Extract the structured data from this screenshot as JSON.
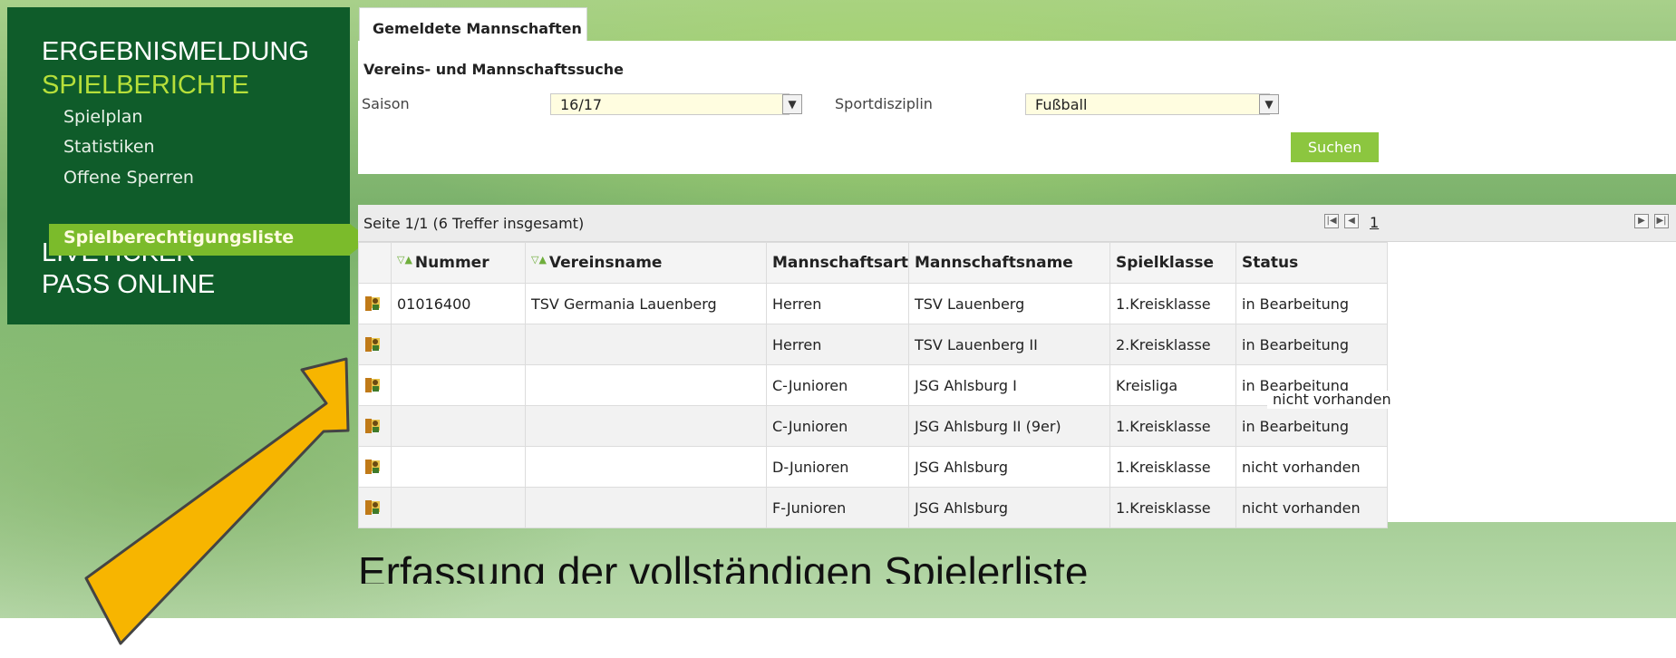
{
  "sidebar": {
    "heading_1": "ERGEBNISMELDUNG",
    "heading_2": "SPIELBERICHTE",
    "items": [
      "Spielplan",
      "Statistiken",
      "Offene Sperren"
    ],
    "active_item": "Spielberechtigungsliste",
    "heading_3": "LIVETICKER",
    "heading_4": "PASS ONLINE"
  },
  "tab": {
    "label": "Gemeldete Mannschaften"
  },
  "search": {
    "title": "Vereins- und Mannschaftssuche",
    "saison_label": "Saison",
    "saison_value": "16/17",
    "sportdisziplin_label": "Sportdisziplin",
    "sportdisziplin_value": "Fußball",
    "button_label": "Suchen"
  },
  "results": {
    "info": "Seite 1/1 (6 Treffer insgesamt)",
    "current_page": "1",
    "columns": [
      "Nummer",
      "Vereinsname",
      "Mannschaftsart",
      "Mannschaftsname",
      "Spielklasse",
      "Status"
    ],
    "rows": [
      {
        "nummer": "01016400",
        "vereinsname": "TSV Germania Lauenberg",
        "art": "Herren",
        "name": "TSV Lauenberg",
        "klasse": "1.Kreisklasse",
        "status": "in Bearbeitung"
      },
      {
        "nummer": "",
        "vereinsname": "",
        "art": "Herren",
        "name": "TSV Lauenberg II",
        "klasse": "2.Kreisklasse",
        "status": "in Bearbeitung"
      },
      {
        "nummer": "",
        "vereinsname": "",
        "art": "C-Junioren",
        "name": "JSG Ahlsburg I",
        "klasse": "Kreisliga",
        "status": "in Bearbeitung"
      },
      {
        "nummer": "",
        "vereinsname": "",
        "art": "C-Junioren",
        "name": "JSG Ahlsburg II (9er)",
        "klasse": "1.Kreisklasse",
        "status": "in Bearbeitung"
      },
      {
        "nummer": "",
        "vereinsname": "",
        "art": "D-Junioren",
        "name": "JSG Ahlsburg",
        "klasse": "1.Kreisklasse",
        "status": "nicht vorhanden"
      },
      {
        "nummer": "",
        "vereinsname": "",
        "art": "F-Junioren",
        "name": "JSG Ahlsburg",
        "klasse": "1.Kreisklasse",
        "status": "nicht vorhanden"
      }
    ],
    "overlay_status": "nicht vorhanden"
  },
  "annotation": {
    "arrow_color": "#f7b500",
    "caption": "Erfassung der vollständigen Spielerliste"
  },
  "colors": {
    "sidebar_bg": "#0f5c2a",
    "accent_green": "#8cc63f",
    "heading_green": "#b6df3a"
  }
}
